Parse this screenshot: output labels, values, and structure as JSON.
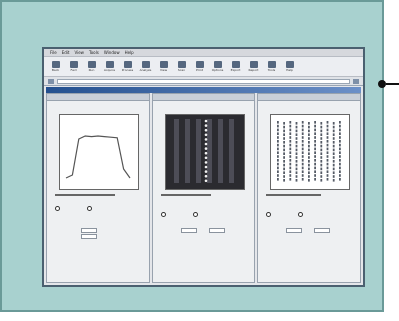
{
  "menu": [
    "File",
    "Edit",
    "View",
    "Tools",
    "Window",
    "Help"
  ],
  "toolbar": [
    {
      "label": "Back",
      "icon": "back-icon"
    },
    {
      "label": "Fwd",
      "icon": "forward-icon"
    },
    {
      "label": "Run",
      "icon": "run-icon"
    },
    {
      "label": "Acquire",
      "icon": "acquire-icon"
    },
    {
      "label": "Process",
      "icon": "process-icon"
    },
    {
      "label": "Analyze",
      "icon": "analyze-icon"
    },
    {
      "label": "View",
      "icon": "view-icon"
    },
    {
      "label": "Scan",
      "icon": "scan-icon"
    },
    {
      "label": "Print",
      "icon": "print-icon"
    },
    {
      "label": "Options",
      "icon": "options-icon"
    },
    {
      "label": "Export",
      "icon": "export-icon"
    },
    {
      "label": "Report",
      "icon": "report-icon"
    },
    {
      "label": "Tools",
      "icon": "tools-icon"
    },
    {
      "label": "Help",
      "icon": "help-icon"
    }
  ],
  "colors": {
    "frame": "#a8d1cf",
    "titlebar": "#24508f",
    "plot_line": "#555555"
  },
  "chart_data": [
    {
      "type": "line",
      "x": [
        0,
        1,
        2,
        3,
        4,
        5,
        6,
        7,
        8,
        9,
        10
      ],
      "values": [
        0.05,
        0.1,
        0.7,
        0.75,
        0.74,
        0.75,
        0.74,
        0.73,
        0.72,
        0.2,
        0.05
      ]
    },
    {
      "type": "heatmap"
    },
    {
      "type": "scatter"
    }
  ]
}
